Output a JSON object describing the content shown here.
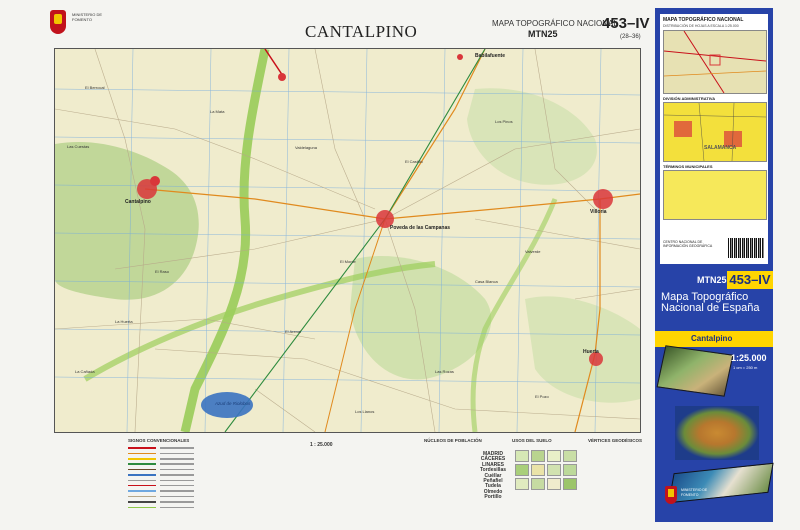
{
  "header": {
    "ministry": "MINISTERIO DE FOMENTO",
    "title": "CANTALPINO",
    "series_label": "MAPA TOPOGRÁFICO NACIONAL",
    "series_code": "MTN25",
    "sheet_number": "453–IV",
    "sheet_grid": "(28–36)"
  },
  "map": {
    "towns": [
      {
        "id": "cantalpino",
        "label": "Cantalpino"
      },
      {
        "id": "villoria",
        "label": "Villoria"
      },
      {
        "id": "poveda",
        "label": "Poveda de las Campanas"
      },
      {
        "id": "babilafuente",
        "label": "Babilafuente"
      },
      {
        "id": "huerta",
        "label": "Huerta"
      }
    ],
    "lake_label": "Azud de Riolobos",
    "places": [
      "El Berrocal",
      "La Mata",
      "Valdelaguna",
      "El Castillo",
      "Las Cuestas",
      "Los Pinos",
      "El Monte",
      "Casa Blanca",
      "La Huerta",
      "El Arenal",
      "Las Rozas",
      "Valverde",
      "El Raso",
      "La Cañada",
      "Los Llanos",
      "El Pozo"
    ],
    "colors": {
      "base": "#f0eccd",
      "pine": "#b9d48f",
      "forest": "#c9dea6",
      "stream": "#8fc84a",
      "road_main": "#c8101a",
      "road_secondary": "#e08a1e",
      "water": "#3a73c1",
      "grid": "#6fa8e0",
      "urban": "#d9363a"
    }
  },
  "legend": {
    "signs_title": "SIGNOS CONVENCIONALES",
    "scale_label": "1 : 25.000",
    "population_title": "NÚCLEOS DE POBLACIÓN",
    "population_examples": [
      "MADRID",
      "CÁCERES",
      "LINARES",
      "Tordesillas",
      "Cuéllar",
      "Peñafiel",
      "Tudela",
      "Olmedo",
      "Portillo"
    ],
    "land_use_title": "USOS DEL SUELO",
    "geodesic_title": "VÉRTICES GEODÉSICOS"
  },
  "cover": {
    "inset_title": "MAPA TOPOGRÁFICO NACIONAL",
    "inset_subtitle": "DISTRIBUCIÓN DE HOJAS A ESCALA 1:25.000",
    "admin_title": "DIVISIÓN ADMINISTRATIVA",
    "admin_region": "SALAMANCA",
    "muni_title": "TÉRMINOS MUNICIPALES",
    "ign_name": "CENTRO NACIONAL DE INFORMACIÓN GEOGRÁFICA",
    "mtn_code": "MTN25",
    "sheet_number": "453–IV",
    "series_title": "Mapa Topográfico Nacional de España",
    "sheet_name": "Cantalpino",
    "scale": "1:25.000",
    "scale_sub": "1 cm = 250 m",
    "ministry": "MINISTERIO DE FOMENTO"
  }
}
